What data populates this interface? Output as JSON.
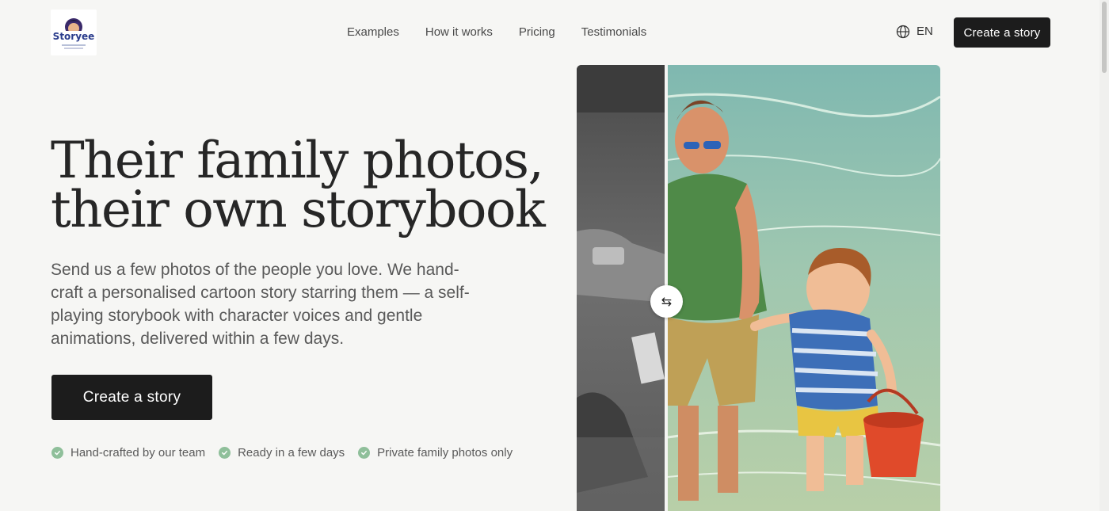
{
  "header": {
    "logo_text": "Storyee",
    "nav": [
      "Examples",
      "How it works",
      "Pricing",
      "Testimonials"
    ],
    "language": "EN",
    "cta_label": "Create a story"
  },
  "hero": {
    "headline_line1": "Their family photos,",
    "headline_line2": "their own storybook",
    "description": "Send us a few photos of the people you love. We hand-craft a personalised cartoon story starring them — a self-playing storybook with character voices and gentle animations, delivered within a few days.",
    "cta_label": "Create a story",
    "perks": [
      "Hand-crafted by our team",
      "Ready in a few days",
      "Private family photos only"
    ]
  },
  "compare": {
    "handle_icon": "swap-arrows-icon",
    "handle_glyph": "⇆"
  },
  "colors": {
    "button_bg": "#1c1c1c",
    "background": "#f6f6f4",
    "check_green": "#8fbf9a"
  }
}
